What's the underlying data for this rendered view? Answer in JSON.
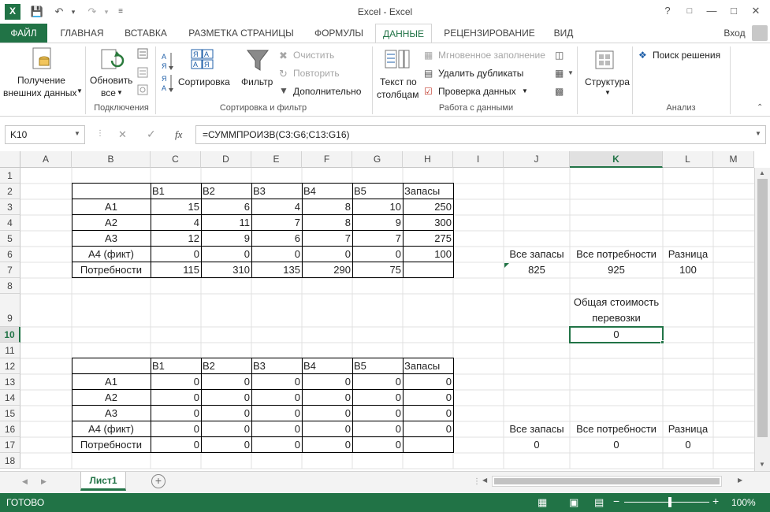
{
  "window": {
    "title": "Excel - Excel",
    "login": "Вход"
  },
  "tabs": [
    "ФАЙЛ",
    "ГЛАВНАЯ",
    "ВСТАВКА",
    "РАЗМЕТКА СТРАНИЦЫ",
    "ФОРМУЛЫ",
    "ДАННЫЕ",
    "РЕЦЕНЗИРОВАНИЕ",
    "ВИД"
  ],
  "ribbon": {
    "get_external_1": "Получение",
    "get_external_2": "внешних данных",
    "refresh_1": "Обновить",
    "refresh_2": "все",
    "connections_group": "Подключения",
    "sort": "Сортировка",
    "filter": "Фильтр",
    "clear": "Очистить",
    "reapply": "Повторить",
    "advanced": "Дополнительно",
    "sort_filter_group": "Сортировка и фильтр",
    "text_cols_1": "Текст по",
    "text_cols_2": "столбцам",
    "flash_fill": "Мгновенное заполнение",
    "remove_dup": "Удалить дубликаты",
    "validation": "Проверка данных",
    "data_tools_group": "Работа с данными",
    "outline": "Структура",
    "solver": "Поиск решения",
    "analysis_group": "Анализ"
  },
  "formula_bar": {
    "name_box": "K10",
    "fx": "fx",
    "formula": "=СУММПРОИЗВ(C3:G6;C13:G16)"
  },
  "columns": [
    "A",
    "B",
    "C",
    "D",
    "E",
    "F",
    "G",
    "H",
    "I",
    "J",
    "K",
    "L",
    "M"
  ],
  "rows": [
    "1",
    "2",
    "3",
    "4",
    "5",
    "6",
    "7",
    "8",
    "9",
    "10",
    "11",
    "12",
    "13",
    "14",
    "15",
    "16",
    "17",
    "18"
  ],
  "table1": {
    "headers": [
      "B1",
      "B2",
      "B3",
      "B4",
      "B5",
      "Запасы"
    ],
    "rows": [
      {
        "label": "A1",
        "vals": [
          "15",
          "6",
          "4",
          "8",
          "10",
          "250"
        ]
      },
      {
        "label": "A2",
        "vals": [
          "4",
          "11",
          "7",
          "8",
          "9",
          "300"
        ]
      },
      {
        "label": "A3",
        "vals": [
          "12",
          "9",
          "6",
          "7",
          "7",
          "275"
        ]
      },
      {
        "label": "A4 (фикт)",
        "vals": [
          "0",
          "0",
          "0",
          "0",
          "0",
          "100"
        ]
      },
      {
        "label": "Потребности",
        "vals": [
          "115",
          "310",
          "135",
          "290",
          "75",
          ""
        ]
      }
    ]
  },
  "table2": {
    "headers": [
      "B1",
      "B2",
      "B3",
      "B4",
      "B5",
      "Запасы"
    ],
    "rows": [
      {
        "label": "A1",
        "vals": [
          "0",
          "0",
          "0",
          "0",
          "0",
          "0"
        ]
      },
      {
        "label": "A2",
        "vals": [
          "0",
          "0",
          "0",
          "0",
          "0",
          "0"
        ]
      },
      {
        "label": "A3",
        "vals": [
          "0",
          "0",
          "0",
          "0",
          "0",
          "0"
        ]
      },
      {
        "label": "A4 (фикт)",
        "vals": [
          "0",
          "0",
          "0",
          "0",
          "0",
          "0"
        ]
      },
      {
        "label": "Потребности",
        "vals": [
          "0",
          "0",
          "0",
          "0",
          "0",
          ""
        ]
      }
    ]
  },
  "summary1": {
    "h1": "Все запасы",
    "h2": "Все потребности",
    "h3": "Разница",
    "v1": "825",
    "v2": "925",
    "v3": "100"
  },
  "cost": {
    "label1": "Общая стоимость",
    "label2": "перевозки",
    "value": "0"
  },
  "summary2": {
    "h1": "Все запасы",
    "h2": "Все потребности",
    "h3": "Разница",
    "v1": "0",
    "v2": "0",
    "v3": "0"
  },
  "sheet": {
    "name": "Лист1"
  },
  "status": {
    "ready": "ГОТОВО",
    "zoom": "100%"
  },
  "colors": {
    "accent": "#217346"
  }
}
